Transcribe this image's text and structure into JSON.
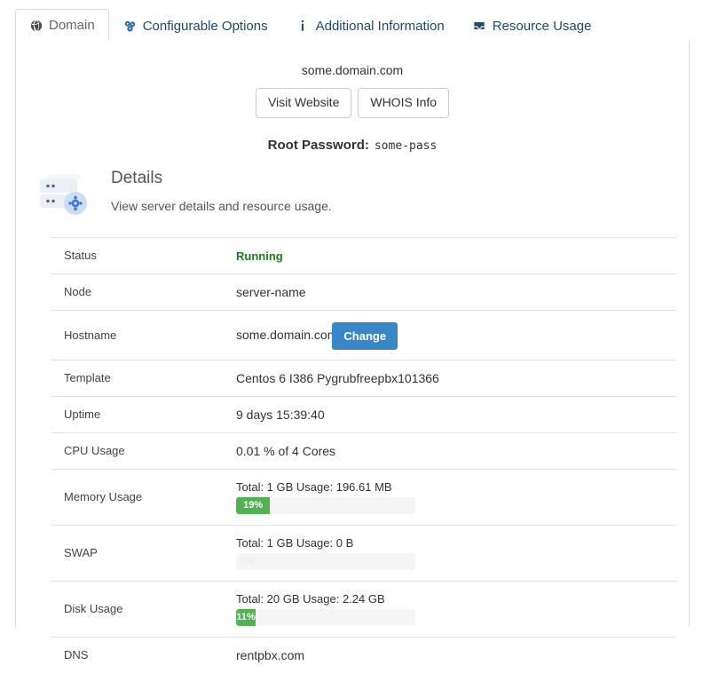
{
  "tabs": [
    {
      "label": "Domain",
      "icon": "globe-icon",
      "active": true
    },
    {
      "label": "Configurable Options",
      "icon": "puzzle-icon",
      "active": false
    },
    {
      "label": "Additional Information",
      "icon": "info-icon",
      "active": false
    },
    {
      "label": "Resource Usage",
      "icon": "inbox-icon",
      "active": false
    }
  ],
  "header": {
    "domain": "some.domain.com",
    "visit_website_label": "Visit Website",
    "whois_info_label": "WHOIS Info",
    "root_password_label": "Root Password:",
    "root_password_value": "some-pass"
  },
  "details": {
    "title": "Details",
    "subtitle": "View server details and resource usage.",
    "icon": "server-gear-icon"
  },
  "table": {
    "rows": [
      {
        "label": "Status",
        "type": "status",
        "value": "Running"
      },
      {
        "label": "Node",
        "type": "text",
        "value": "server-name"
      },
      {
        "label": "Hostname",
        "type": "hostname",
        "value": "some.domain.com",
        "button_label": "Change"
      },
      {
        "label": "Template",
        "type": "text",
        "value": "Centos 6 I386 Pygrubfreepbx101366"
      },
      {
        "label": "Uptime",
        "type": "text",
        "value": "9 days 15:39:40"
      },
      {
        "label": "CPU Usage",
        "type": "text",
        "value": "0.01 % of 4 Cores"
      },
      {
        "label": "Memory Usage",
        "type": "progress",
        "value": "Total: 1 GB Usage: 196.61 MB",
        "percent_label": "19%",
        "percent": 19
      },
      {
        "label": "SWAP",
        "type": "progress",
        "value": "Total: 1 GB Usage: 0 B",
        "percent_label": "0%",
        "percent": 0
      },
      {
        "label": "Disk Usage",
        "type": "progress",
        "value": "Total: 20 GB Usage: 2.24 GB",
        "percent_label": "11%",
        "percent": 11
      },
      {
        "label": "DNS",
        "type": "text",
        "value": "rentpbx.com"
      }
    ]
  },
  "colors": {
    "tab_link": "#1c4b6e",
    "active_tab_text": "#666666",
    "status_running": "#1e7b1e",
    "primary_button": "#3a87c8",
    "progress_fill": "#53b153",
    "progress_track": "#f5f5f5",
    "border": "#dddddd"
  }
}
